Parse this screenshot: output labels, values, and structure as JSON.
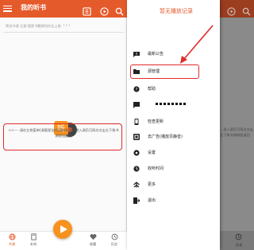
{
  "left": {
    "title": "我的听书",
    "filter_placeholder": "筛选书源 注意:搜索书籍按钮在右上角. *.*.*",
    "hint": "<<---- 请在左侧菜单[源管理]启用喜欢的源，进入源后可再次点击左下角书源按钮返回",
    "nav": [
      {
        "label": "书源",
        "icon": "globe-icon"
      },
      {
        "label": "未知",
        "icon": "book-icon"
      },
      {
        "label": "收藏",
        "icon": "heart-icon"
      },
      {
        "label": "历史",
        "icon": "history-icon"
      }
    ],
    "logo_text": "听",
    "colors": {
      "accent": "#e55a2b",
      "fab": "#f7921e",
      "highlight": "#e02b2b"
    }
  },
  "right": {
    "now_playing": "暂无播放记录",
    "menu": [
      {
        "label": "最新公告",
        "icon": "announcement-icon"
      },
      {
        "label": "源管理",
        "icon": "folder-icon"
      },
      {
        "label": "帮助",
        "icon": "help-icon"
      },
      {
        "label": "",
        "icon": "chat-icon"
      },
      {
        "label": "检查更新",
        "icon": "update-icon"
      },
      {
        "label": "去广告(播放页静音)",
        "icon": "ad-icon"
      },
      {
        "label": "设置",
        "icon": "settings-icon"
      },
      {
        "label": "收听时间",
        "icon": "timer-icon"
      },
      {
        "label": "更多",
        "icon": "more-icon"
      },
      {
        "label": "退出",
        "icon": "exit-icon"
      }
    ],
    "side_hint": "，进入源后可再次点击左下角书源按钮返回",
    "bottom_label": "历史"
  }
}
